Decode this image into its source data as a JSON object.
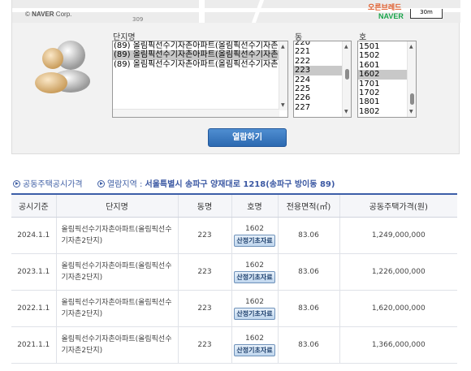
{
  "map": {
    "copyright_symbol": "©",
    "copyright_brand": "NAVER",
    "copyright_suffix": "Corp.",
    "road_number": "309",
    "brand_label": "오른브레드",
    "logo": "NAVER",
    "scale_label": "30m"
  },
  "selectors": {
    "complex_label": "단지명",
    "complex_options": [
      {
        "label": "(89) 올림픽선수기자촌아파트(올림픽선수기자촌",
        "selected": false
      },
      {
        "label": "(89) 올림픽선수기자촌아파트(올림픽선수기자촌",
        "selected": true
      },
      {
        "label": "(89) 올림픽선수기자촌아파트(올림픽선수기자촌",
        "selected": false
      }
    ],
    "dong_label": "동",
    "dong_options": [
      {
        "label": "220",
        "selected": false
      },
      {
        "label": "221",
        "selected": false
      },
      {
        "label": "222",
        "selected": false
      },
      {
        "label": "223",
        "selected": true
      },
      {
        "label": "224",
        "selected": false
      },
      {
        "label": "225",
        "selected": false
      },
      {
        "label": "226",
        "selected": false
      },
      {
        "label": "227",
        "selected": false
      }
    ],
    "ho_label": "호",
    "ho_options": [
      {
        "label": "1501",
        "selected": false
      },
      {
        "label": "1502",
        "selected": false
      },
      {
        "label": "1601",
        "selected": false
      },
      {
        "label": "1602",
        "selected": true
      },
      {
        "label": "1701",
        "selected": false
      },
      {
        "label": "1702",
        "selected": false
      },
      {
        "label": "1801",
        "selected": false
      },
      {
        "label": "1802",
        "selected": false
      }
    ],
    "view_button": "열람하기"
  },
  "legend": {
    "item1": "공동주택공시가격",
    "item2_label": "열람지역 :",
    "item2_value": "서울특별시 송파구 양재대로 1218(송파구 방이동 89)"
  },
  "table": {
    "headers": [
      "공시기준",
      "단지명",
      "동명",
      "호명",
      "전용면적(㎡)",
      "공동주택가격(원)"
    ],
    "rows": [
      {
        "date": "2024.1.1",
        "name": "올림픽선수기자촌아파트(올림픽선수기자촌2단지)",
        "dong": "223",
        "ho": "1602",
        "calc": "산정기초자료",
        "area": "83.06",
        "price": "1,249,000,000"
      },
      {
        "date": "2023.1.1",
        "name": "올림픽선수기자촌아파트(올림픽선수기자촌2단지)",
        "dong": "223",
        "ho": "1602",
        "calc": "산정기초자료",
        "area": "83.06",
        "price": "1,226,000,000"
      },
      {
        "date": "2022.1.1",
        "name": "올림픽선수기자촌아파트(올림픽선수기자촌2단지)",
        "dong": "223",
        "ho": "1602",
        "calc": "산정기초자료",
        "area": "83.06",
        "price": "1,620,000,000"
      },
      {
        "date": "2021.1.1",
        "name": "올림픽선수기자촌아파트(올림픽선수기자촌2단지)",
        "dong": "223",
        "ho": "1602",
        "calc": "산정기초자료",
        "area": "83.06",
        "price": "1,366,000,000"
      }
    ]
  },
  "colors": {
    "accent": "#3c5ea8",
    "button": "#2c69b1"
  }
}
